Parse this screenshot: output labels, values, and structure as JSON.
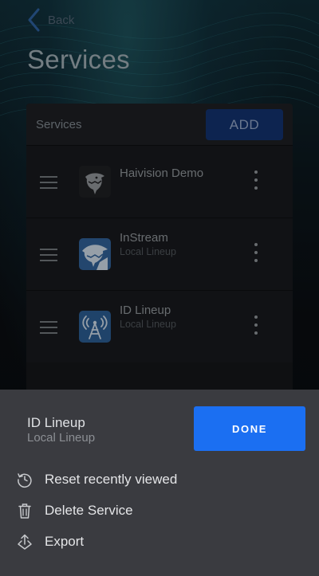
{
  "nav": {
    "back_label": "Back"
  },
  "page": {
    "title": "Services"
  },
  "panel": {
    "header_label": "Services",
    "add_label": "ADD",
    "items": [
      {
        "name": "Haivision Demo",
        "subtitle": "",
        "icon": "shark-logo-icon"
      },
      {
        "name": "InStream",
        "subtitle": "Local Lineup",
        "icon": "instream-logo-icon"
      },
      {
        "name": "ID Lineup",
        "subtitle": "Local Lineup",
        "icon": "antenna-tower-icon"
      }
    ]
  },
  "sheet": {
    "service_name": "ID Lineup",
    "service_subtitle": "Local Lineup",
    "done_label": "DONE",
    "menu": [
      {
        "label": "Reset recently viewed",
        "icon": "reset-icon"
      },
      {
        "label": "Delete Service",
        "icon": "trash-icon"
      },
      {
        "label": "Export",
        "icon": "export-icon"
      }
    ]
  },
  "colors": {
    "accent": "#1b6ff2",
    "add_button": "#12316b",
    "sheet_background": "#3a3b40"
  }
}
